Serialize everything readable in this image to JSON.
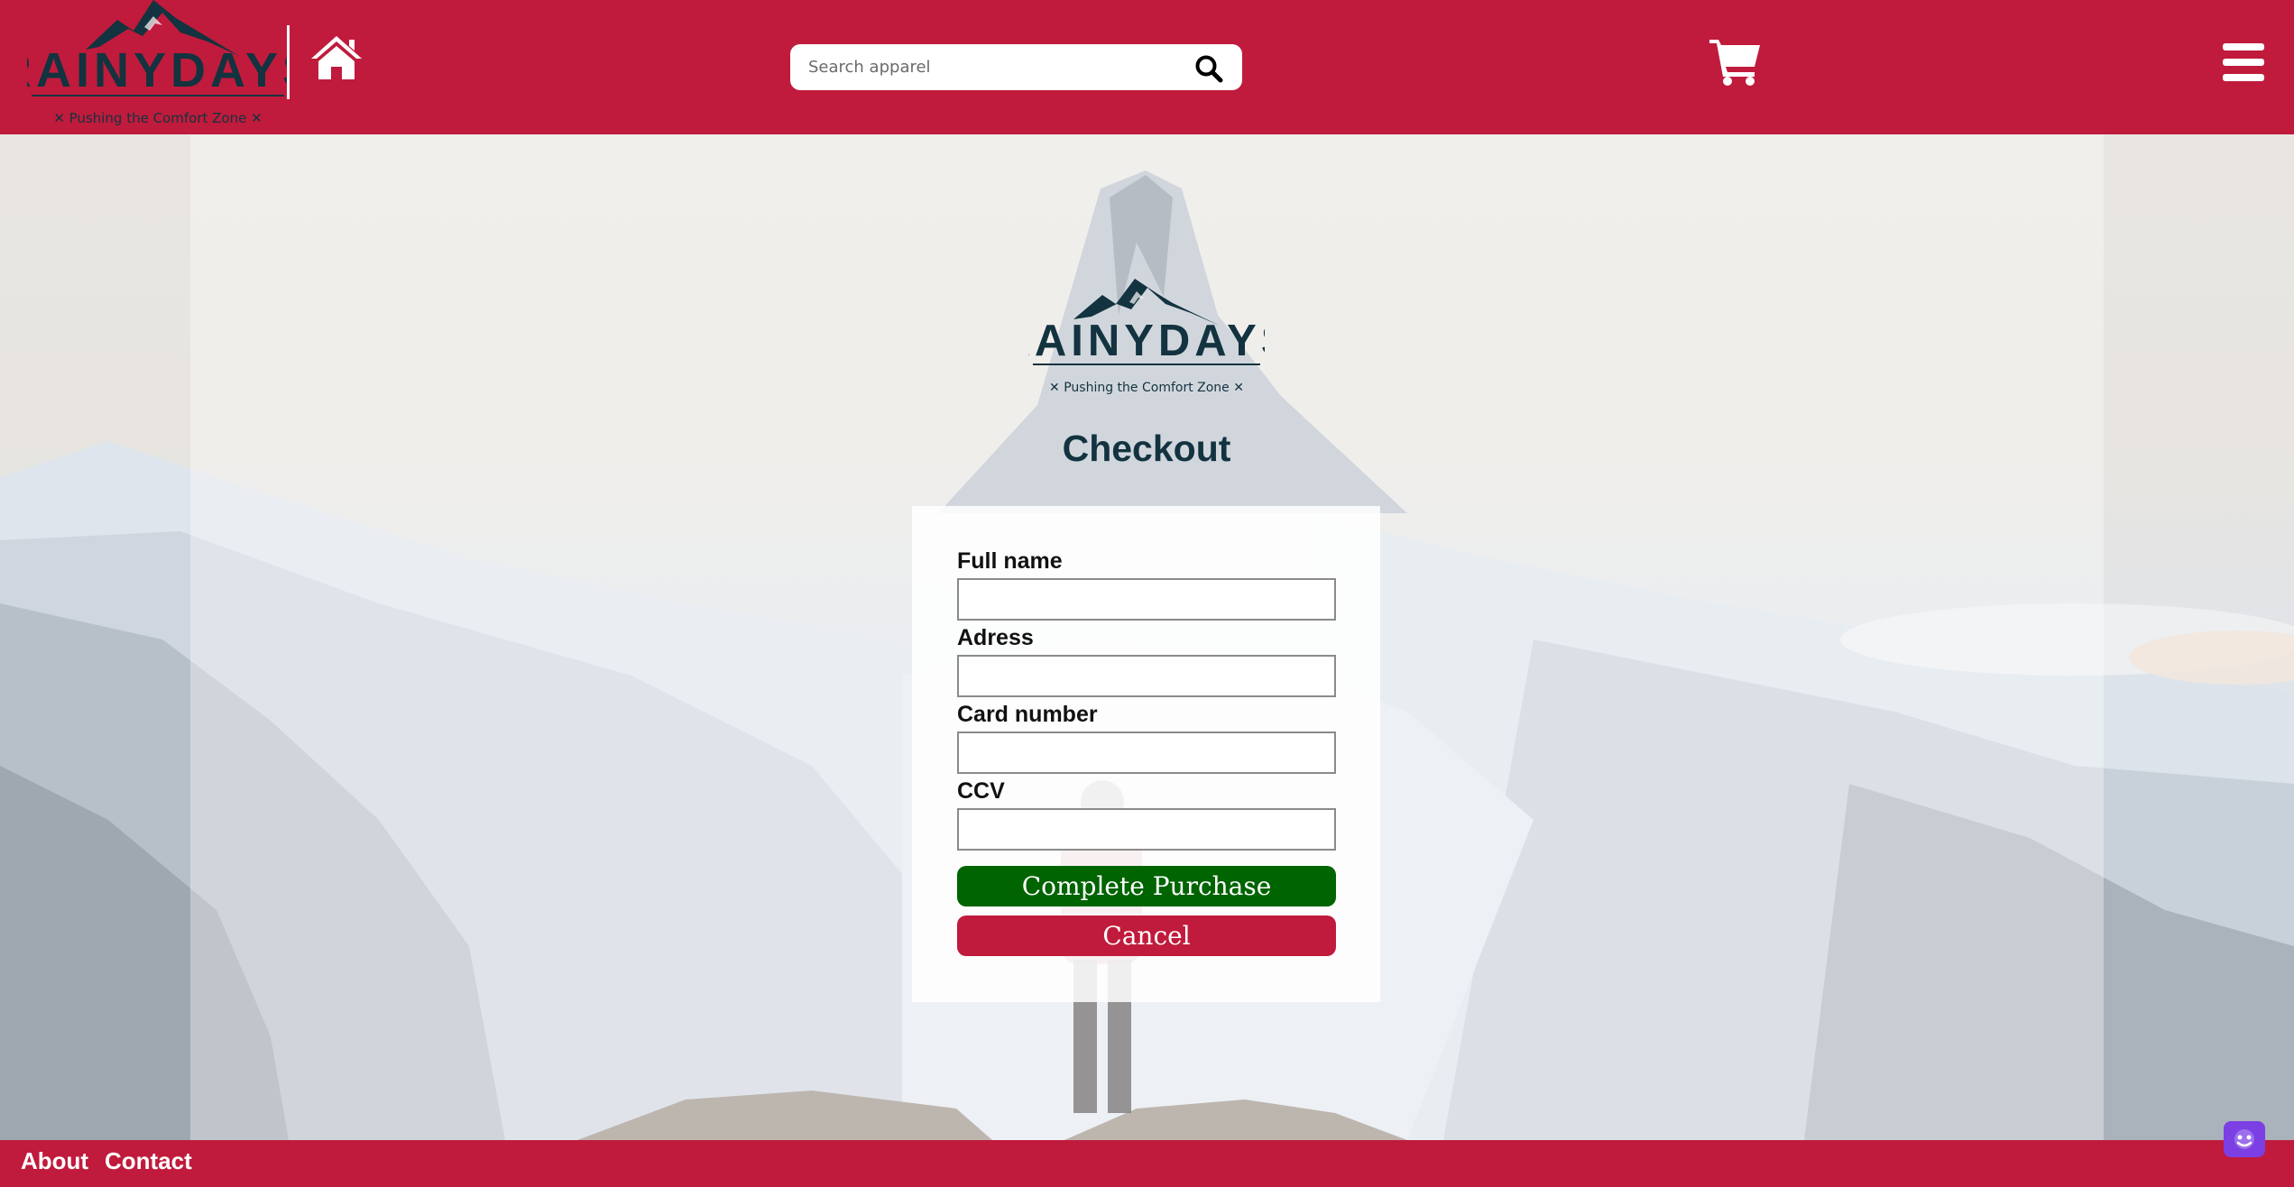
{
  "header": {
    "logo_text": "RAINYDAYS",
    "logo_tagline": "✕ Pushing the Comfort Zone ✕",
    "search_placeholder": "Search apparel"
  },
  "main": {
    "logo_text": "RAINYDAYS",
    "logo_tagline": "✕ Pushing the Comfort Zone ✕",
    "title": "Checkout",
    "form": {
      "fields": [
        {
          "label": "Full name",
          "value": ""
        },
        {
          "label": "Adress",
          "value": ""
        },
        {
          "label": "Card number",
          "value": ""
        },
        {
          "label": "CCV",
          "value": ""
        }
      ],
      "complete_label": "Complete Purchase",
      "cancel_label": "Cancel"
    }
  },
  "footer": {
    "links": [
      "About",
      "Contact"
    ]
  },
  "icons": {
    "home": "home-icon",
    "search": "search-icon",
    "cart": "cart-icon",
    "menu": "hamburger-menu-icon",
    "chat": "chat-widget-icon"
  },
  "colors": {
    "brand_red": "#c01b3c",
    "dark_teal": "#12333f",
    "complete_green": "#006400",
    "chat_purple": "#7b3fe4"
  }
}
